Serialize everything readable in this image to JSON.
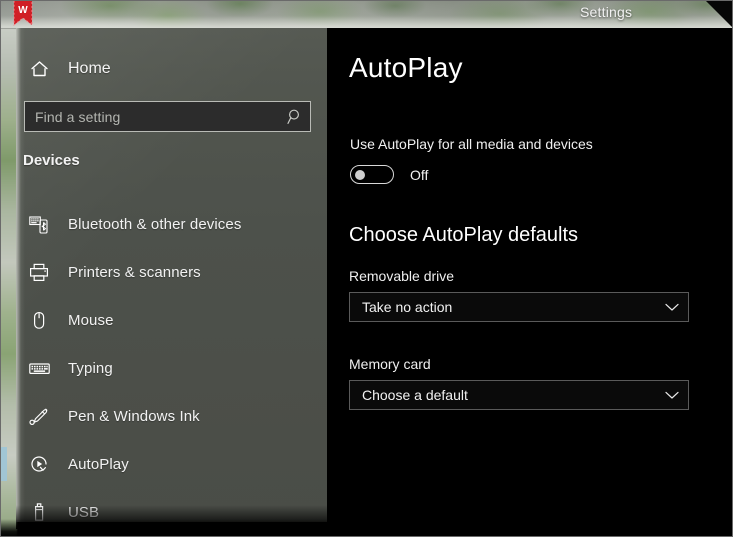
{
  "window": {
    "title": "Settings",
    "app_icon": "bookmark-ribbon-w-icon",
    "accent_selection_color": "#9fc5d6",
    "sidebar_color": "#4d514b",
    "content_background": "#000000"
  },
  "sidebar": {
    "home": {
      "label": "Home",
      "icon": "home-icon"
    },
    "search": {
      "placeholder": "Find a setting",
      "value": "",
      "icon": "search-icon"
    },
    "section_header": "Devices",
    "items": [
      {
        "label": "Bluetooth & other devices",
        "icon": "bluetooth-devices-icon",
        "selected": false
      },
      {
        "label": "Printers & scanners",
        "icon": "printer-icon",
        "selected": false
      },
      {
        "label": "Mouse",
        "icon": "mouse-icon",
        "selected": false
      },
      {
        "label": "Typing",
        "icon": "keyboard-icon",
        "selected": false
      },
      {
        "label": "Pen & Windows Ink",
        "icon": "pen-icon",
        "selected": false
      },
      {
        "label": "AutoPlay",
        "icon": "autoplay-icon",
        "selected": true
      },
      {
        "label": "USB",
        "icon": "usb-drive-icon",
        "selected": false
      }
    ]
  },
  "main": {
    "page_title": "AutoPlay",
    "toggle": {
      "label": "Use AutoPlay for all media and devices",
      "state_text": "Off",
      "checked": false
    },
    "defaults_heading": "Choose AutoPlay defaults",
    "fields": [
      {
        "label": "Removable drive",
        "value": "Take no action",
        "caret_icon": "chevron-down-icon"
      },
      {
        "label": "Memory card",
        "value": "Choose a default",
        "caret_icon": "chevron-down-icon"
      }
    ]
  }
}
